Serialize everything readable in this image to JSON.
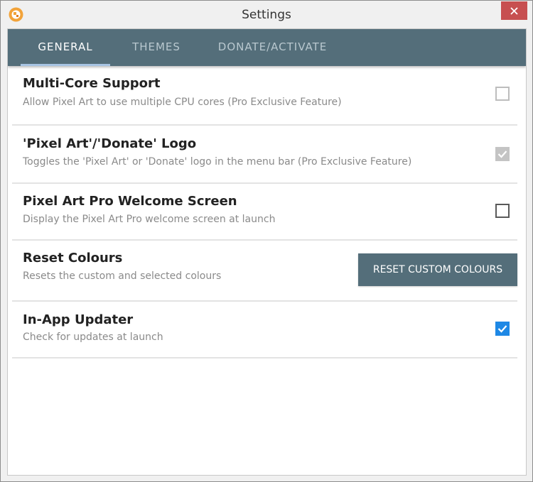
{
  "window": {
    "title": "Settings",
    "app_icon": "pixel-art-app-icon",
    "close_icon": "close-icon",
    "close_color": "#c74f50"
  },
  "tabs": [
    {
      "label": "GENERAL",
      "active": true
    },
    {
      "label": "THEMES",
      "active": false
    },
    {
      "label": "DONATE/ACTIVATE",
      "active": false
    }
  ],
  "colors": {
    "accent": "#546e7a",
    "tab_underline": "#a7c4e3",
    "checkbox_checked": "#1e88e5"
  },
  "settings": [
    {
      "title": "Multi-Core Support",
      "description": "Allow Pixel Art to use multiple CPU cores (Pro Exclusive Feature)",
      "control": "checkbox",
      "checked": false,
      "enabled": false
    },
    {
      "title": "'Pixel Art'/'Donate' Logo",
      "description": "Toggles the 'Pixel Art' or 'Donate' logo in the menu bar (Pro Exclusive Feature)",
      "control": "checkbox",
      "checked": true,
      "enabled": false
    },
    {
      "title": "Pixel Art Pro Welcome Screen",
      "description": "Display the Pixel Art Pro welcome screen at launch",
      "control": "checkbox",
      "checked": false,
      "enabled": true
    },
    {
      "title": "Reset Colours",
      "description": "Resets the custom and selected colours",
      "control": "button",
      "button_label": "RESET CUSTOM COLOURS"
    },
    {
      "title": "In-App Updater",
      "description": "Check for updates at launch",
      "control": "checkbox",
      "checked": true,
      "enabled": true
    }
  ]
}
